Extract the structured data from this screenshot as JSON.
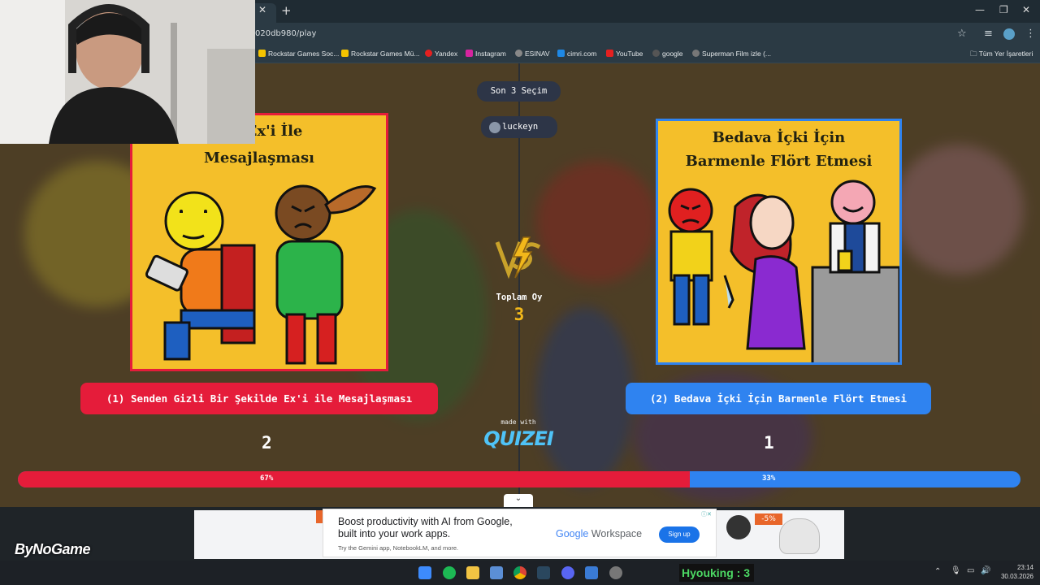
{
  "browser": {
    "url_fragment": "020db980/play",
    "bookmarks": [
      {
        "label": "Rockstar Games Soc...",
        "color": "#f4c300"
      },
      {
        "label": "Rockstar Games Mü...",
        "color": "#f4c300"
      },
      {
        "label": "Yandex",
        "color": "#e52020"
      },
      {
        "label": "Instagram",
        "color": "#d6249f"
      },
      {
        "label": "ESINAV",
        "color": "#888888"
      },
      {
        "label": "cimri.com",
        "color": "#1e88e5"
      },
      {
        "label": "YouTube",
        "color": "#e52020"
      },
      {
        "label": "google",
        "color": "#555555"
      },
      {
        "label": "Superman Film izle (...",
        "color": "#777777"
      }
    ],
    "all_bookmarks_label": "Tüm Yer İşaretleri"
  },
  "quiz": {
    "last_selection_label": "Son 3 Seçim",
    "player": "luckeyn",
    "total_votes_label": "Toplam Oy",
    "total_votes": "3",
    "vs_label": "VS",
    "made_with": "made with",
    "brand": "QUIZEI",
    "option1": {
      "card_title_line1": "izli Ex'i İle",
      "card_title_line2": "Mesajlaşması",
      "button": "(1) Senden Gizli Bir Şekilde Ex'i ile Mesajlaşması",
      "count": "2",
      "percent": "67%",
      "fraction": 0.67,
      "color": "#e51c3a"
    },
    "option2": {
      "card_title_line1": "Bedava İçki İçin",
      "card_title_line2": "Barmenle Flört Etmesi",
      "button": "(2) Bedava İçki İçin Barmenle Flört Etmesi",
      "count": "1",
      "percent": "33%",
      "fraction": 0.33,
      "color": "#2f83f0"
    }
  },
  "ad": {
    "headline1": "Boost productivity with AI from Google,",
    "headline2": "built into your work apps.",
    "sub": "Try the Gemini app, NotebookLM, and more.",
    "brand_google": "Google",
    "brand_workspace": " Workspace",
    "cta": "Sign up",
    "discount": "-5%"
  },
  "overlay": {
    "watermark": "ByNoGame",
    "counter_label": "Hyouking : 3"
  },
  "taskbar": {
    "time": "23:14",
    "date": "30.03.2026"
  }
}
